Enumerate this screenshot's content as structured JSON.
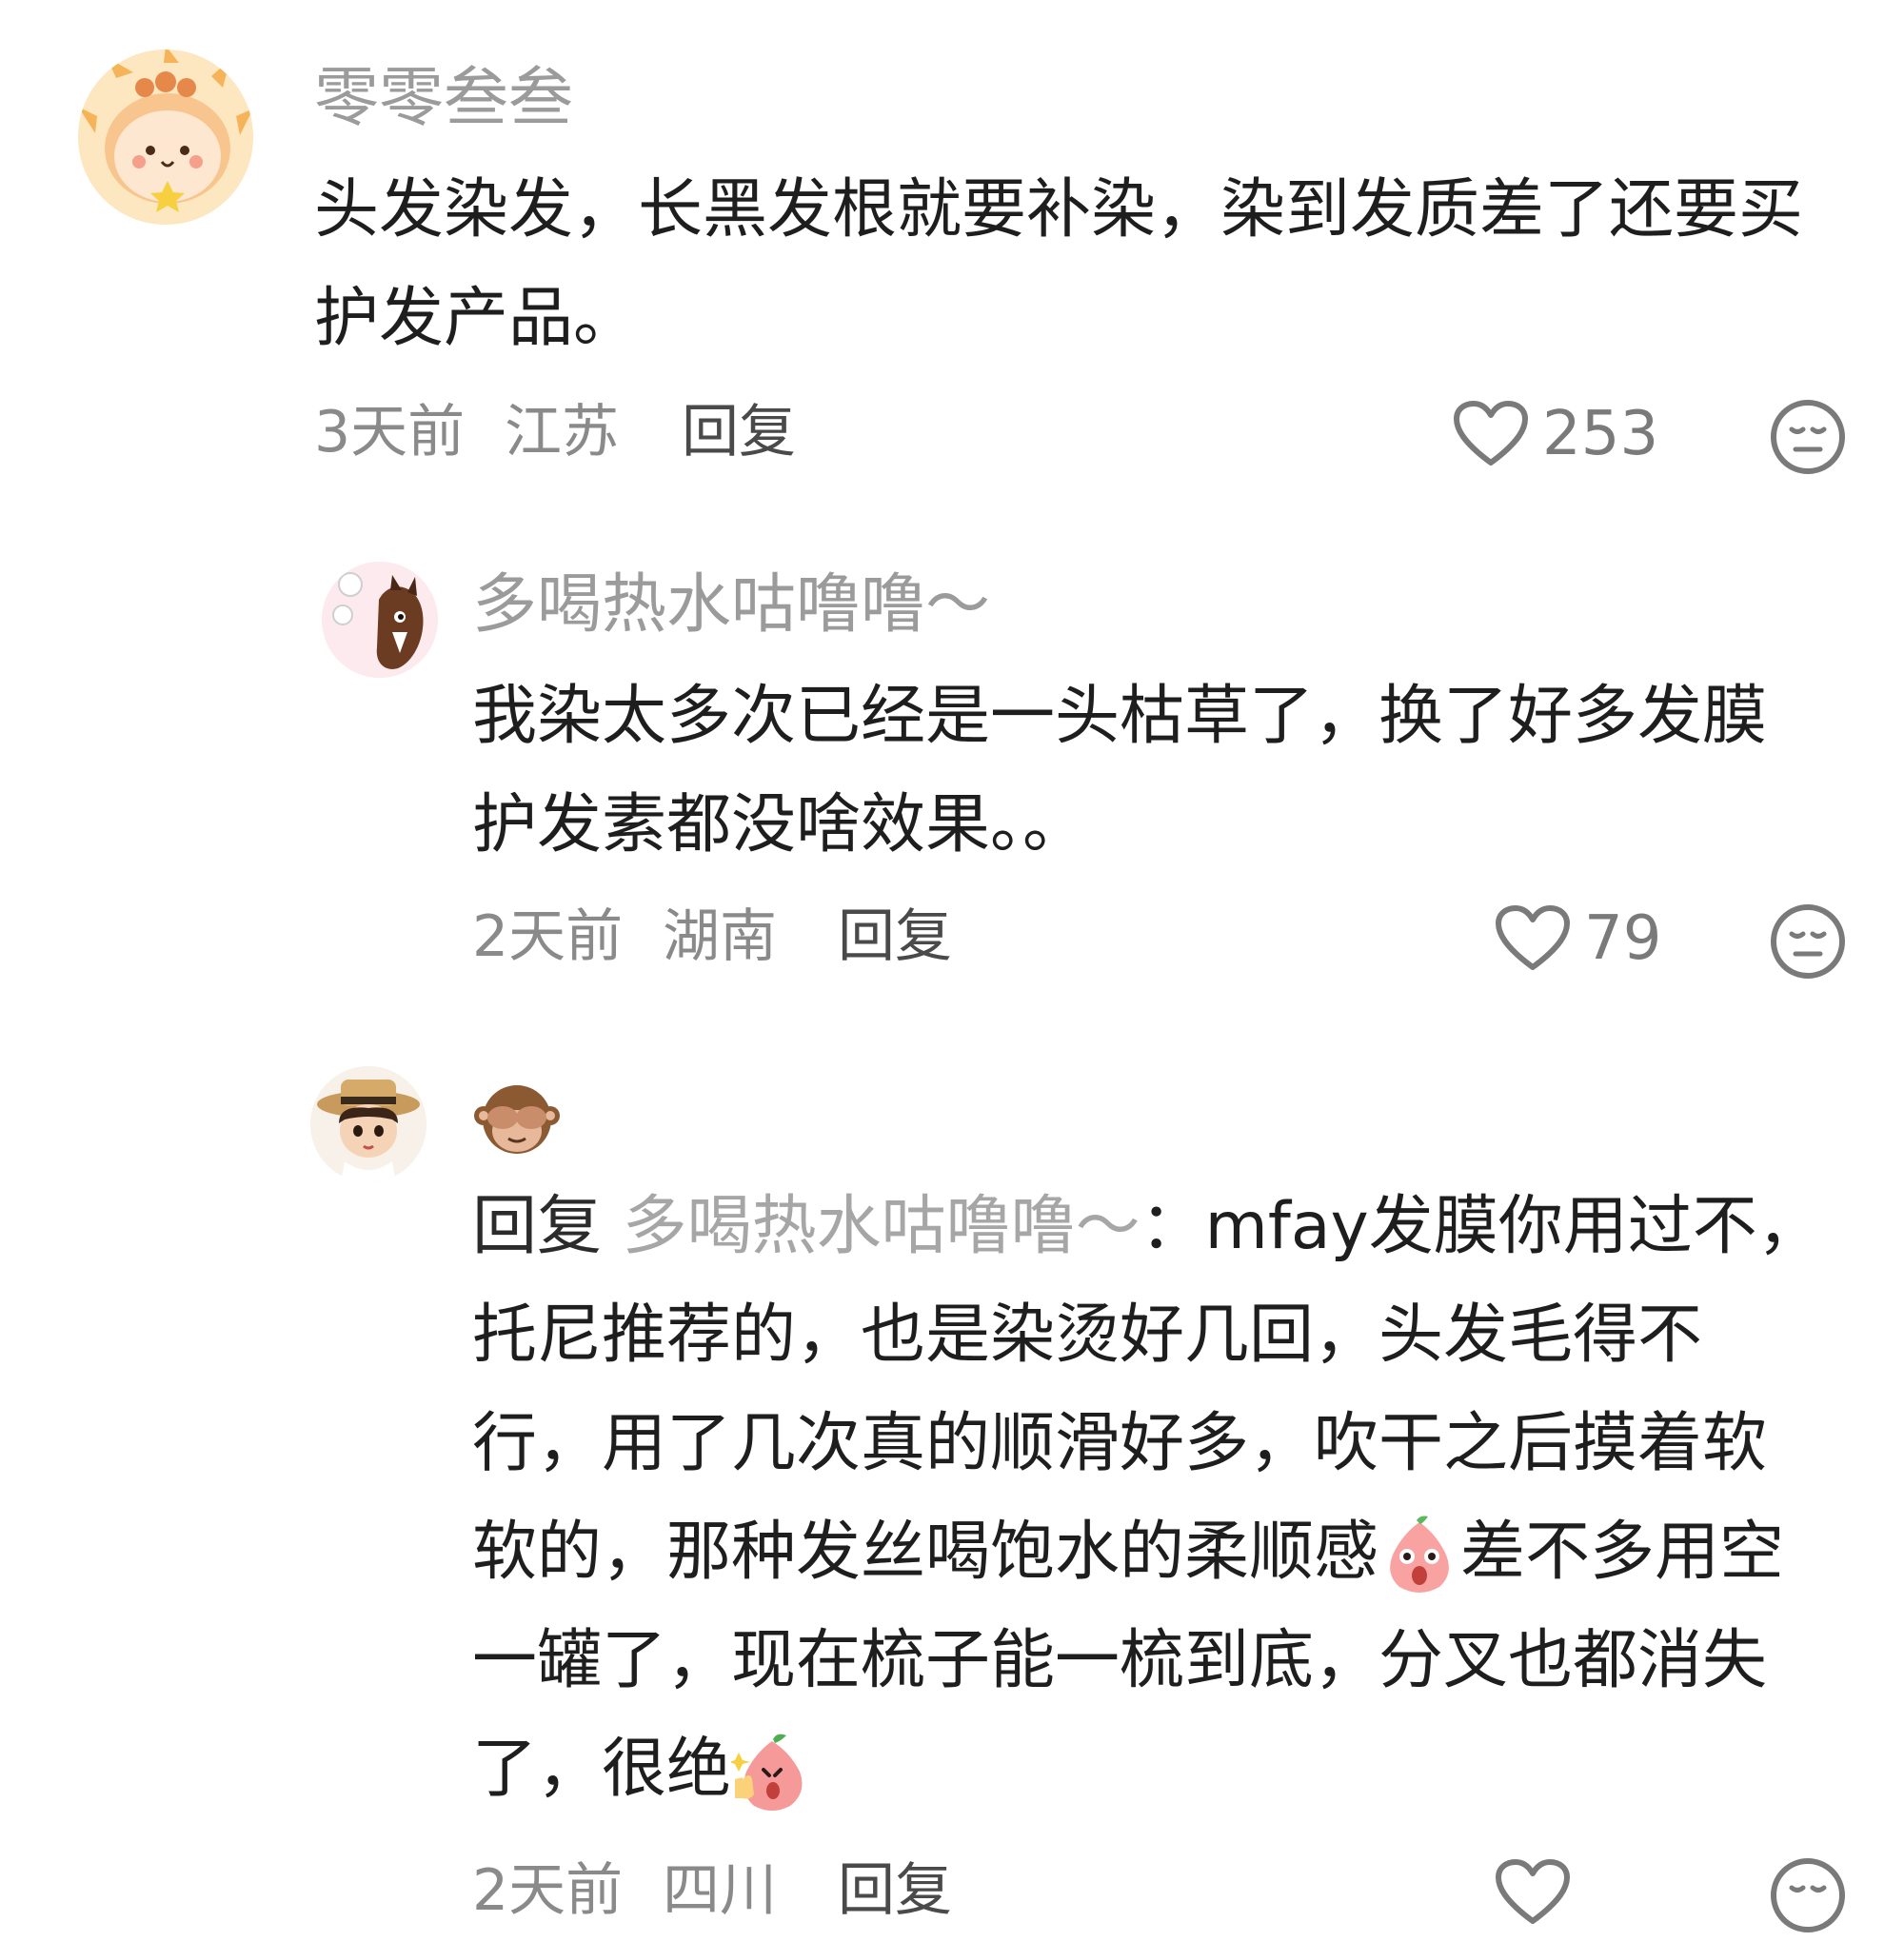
{
  "comments": [
    {
      "username": "零零叁叁",
      "text": "头发染发，长黑发根就要补染，染到发质差了还要买护发产品。",
      "time": "3天前",
      "location": "江苏",
      "reply_label": "回复",
      "likes": "253",
      "avatar_icon": "cartoon-sun-avatar-icon"
    },
    {
      "username": "多喝热水咕噜噜～",
      "text": "我染太多次已经是一头枯草了，换了好多发膜护发素都没啥效果。。",
      "time": "2天前",
      "location": "湖南",
      "reply_label": "回复",
      "likes": "79",
      "avatar_icon": "cartoon-horse-avatar-icon"
    },
    {
      "username_emoji": "🙈",
      "reply_prefix": "回复",
      "reply_target": "多喝热水咕噜噜～",
      "reply_colon": "：",
      "text_part1": "mfay发膜你用过不，托尼推荐的，也是染烫好几回，头发毛得不行，用了几次真的顺滑好多，吹干之后摸着软软的，那种发丝喝饱水的柔顺感",
      "text_part2": "差不多用空一罐了，现在梳子能一梳到底，分叉也都消失了，很绝",
      "time": "2天前",
      "location": "四川",
      "reply_label": "回复",
      "avatar_icon": "doll-straw-hat-avatar-icon"
    }
  ],
  "colors": {
    "username": "#9b9b9b",
    "text": "#1e1e1e",
    "meta": "#8a8a8a",
    "reply": "#4a4a4a"
  }
}
